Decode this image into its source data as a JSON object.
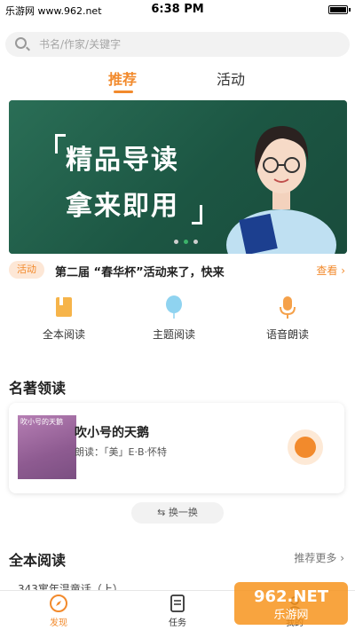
{
  "status_bar": {
    "watermark": "乐游网 www.962.net",
    "time": "6:38 PM"
  },
  "search": {
    "placeholder": "书名/作家/关键字"
  },
  "tabs": [
    {
      "label": "推荐"
    },
    {
      "label": "活动"
    }
  ],
  "banner": {
    "line1": "精品导读",
    "line2": "拿来即用"
  },
  "notice": {
    "badge": "活动",
    "text": "第二届 “春华杯”活动来了，快来",
    "more": "查看 ›"
  },
  "features": [
    {
      "label": "全本阅读"
    },
    {
      "label": "主题阅读"
    },
    {
      "label": "语音朗读"
    }
  ],
  "section_1": {
    "title": "名著领读"
  },
  "book": {
    "cover_title": "吹小号的天鹅",
    "title": "吹小号的天鹅",
    "reader": "朗读：「美」E·B·怀特"
  },
  "swap_label": "⇆ 换一换",
  "section_2": {
    "title": "全本阅读",
    "more": "推荐更多 ›"
  },
  "peek_text": "343寓年温童话（上）",
  "tabbar": [
    {
      "label": "发现"
    },
    {
      "label": "任务"
    },
    {
      "label": "我的"
    }
  ],
  "logo_text": "962.NET 乐游网",
  "colors": {
    "accent": "#f28a2c",
    "chalkboard": "#1f5e49"
  }
}
